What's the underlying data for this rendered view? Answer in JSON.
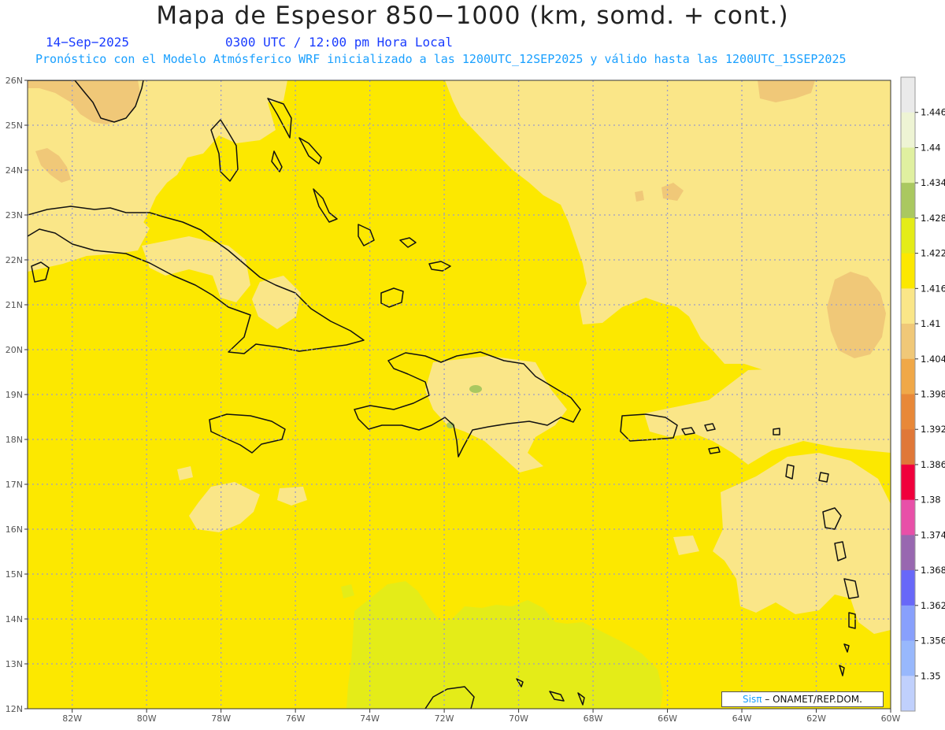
{
  "header": {
    "title": "Mapa de Espesor 850−1000 (km, somd. + cont.)",
    "date": "14−Sep−2025",
    "time": "0300 UTC / 12:00 pm Hora Local",
    "model_info": "Pronóstico con el Modelo Atmósferico WRF inicializado a las 1200UTC_12SEP2025 y válido hasta las  1200UTC_15SEP2025"
  },
  "axes": {
    "lon_labels": [
      "82W",
      "80W",
      "78W",
      "76W",
      "74W",
      "72W",
      "70W",
      "68W",
      "66W",
      "64W",
      "62W",
      "60W"
    ],
    "lat_labels": [
      "26N",
      "25N",
      "24N",
      "23N",
      "22N",
      "21N",
      "20N",
      "19N",
      "18N",
      "17N",
      "16N",
      "15N",
      "14N",
      "13N",
      "12N"
    ],
    "lon_range": [
      -83.2,
      -60
    ],
    "lat_range": [
      12,
      26
    ]
  },
  "colorbar": {
    "labels": [
      "1.446",
      "1.44",
      "1.434",
      "1.428",
      "1.422",
      "1.416",
      "1.41",
      "1.404",
      "1.398",
      "1.392",
      "1.386",
      "1.38",
      "1.374",
      "1.368",
      "1.362",
      "1.356",
      "1.35"
    ],
    "colors_top_to_bottom": [
      "#eaeaea",
      "#eef4d4",
      "#e0f0a0",
      "#aac860",
      "#e4ec18",
      "#fce800",
      "#fae688",
      "#f0c878",
      "#f0a848",
      "#e88838",
      "#e07838",
      "#f0003c",
      "#e850a8",
      "#9868b0",
      "#6868f8",
      "#88a0fc",
      "#98b8fc",
      "#c0d0fc"
    ]
  },
  "fill_colors": {
    "base": "#fce800",
    "light": "#fae688",
    "tan": "#f0c878",
    "lime": "#e4ec18",
    "green": "#aac860"
  },
  "credit": {
    "brand": "Sisπ",
    "text": " – ONAMET/REP.DOM."
  }
}
